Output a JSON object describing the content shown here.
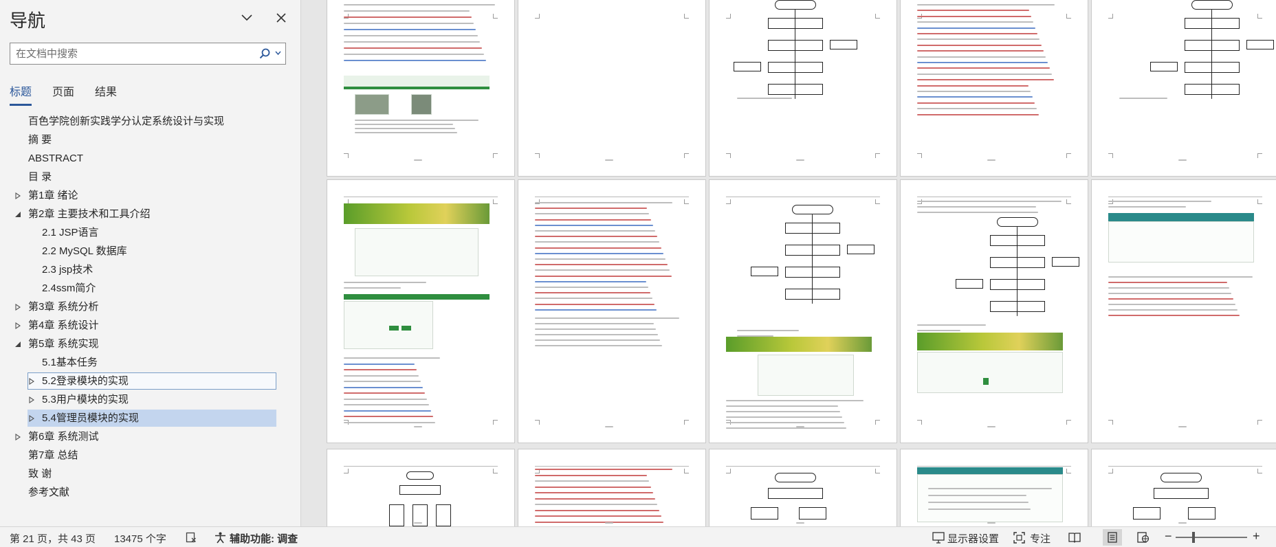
{
  "nav": {
    "title": "导航",
    "search_placeholder": "在文档中搜索",
    "tabs": [
      {
        "label": "标题",
        "active": true
      },
      {
        "label": "页面",
        "active": false
      },
      {
        "label": "结果",
        "active": false
      }
    ],
    "outline": [
      {
        "label": "百色学院创新实践学分认定系统设计与实现",
        "level": 0,
        "arrow": "none"
      },
      {
        "label": "摘 要",
        "level": 0,
        "arrow": "none"
      },
      {
        "label": "ABSTRACT",
        "level": 0,
        "arrow": "none"
      },
      {
        "label": "目 录",
        "level": 0,
        "arrow": "none"
      },
      {
        "label": "第1章 绪论",
        "level": 0,
        "arrow": "collapsed"
      },
      {
        "label": "第2章 主要技术和工具介绍",
        "level": 0,
        "arrow": "expanded"
      },
      {
        "label": "2.1 JSP语言",
        "level": 1,
        "arrow": "none"
      },
      {
        "label": "2.2 MySQL 数据库",
        "level": 1,
        "arrow": "none"
      },
      {
        "label": "2.3 jsp技术",
        "level": 1,
        "arrow": "none"
      },
      {
        "label": "2.4ssm简介",
        "level": 1,
        "arrow": "none"
      },
      {
        "label": "第3章 系统分析",
        "level": 0,
        "arrow": "collapsed"
      },
      {
        "label": "第4章 系统设计",
        "level": 0,
        "arrow": "collapsed"
      },
      {
        "label": "第5章 系统实现",
        "level": 0,
        "arrow": "expanded"
      },
      {
        "label": "5.1基本任务",
        "level": 1,
        "arrow": "none"
      },
      {
        "label": "5.2登录模块的实现",
        "level": 1,
        "arrow": "collapsed",
        "highlight": "outline"
      },
      {
        "label": "5.3用户模块的实现",
        "level": 1,
        "arrow": "collapsed"
      },
      {
        "label": "5.4管理员模块的实现",
        "level": 1,
        "arrow": "collapsed",
        "highlight": "fill"
      },
      {
        "label": "第6章 系统测试",
        "level": 0,
        "arrow": "collapsed"
      },
      {
        "label": "第7章 总结",
        "level": 0,
        "arrow": "none"
      },
      {
        "label": "致 谢",
        "level": 0,
        "arrow": "none"
      },
      {
        "label": "参考文献",
        "level": 0,
        "arrow": "none"
      }
    ]
  },
  "status": {
    "page_info": "第 21 页，共 43 页",
    "word_count": "13475 个字",
    "accessibility": "辅助功能: 调查",
    "display_settings": "显示器设置",
    "focus": "专注",
    "zoom_minus": "−",
    "zoom_plus": "+",
    "zoom_level": 0.25
  },
  "colors": {
    "accent": "#2b579a",
    "selection_fill": "#c3d5ee",
    "selection_border": "#7a9ec8"
  }
}
